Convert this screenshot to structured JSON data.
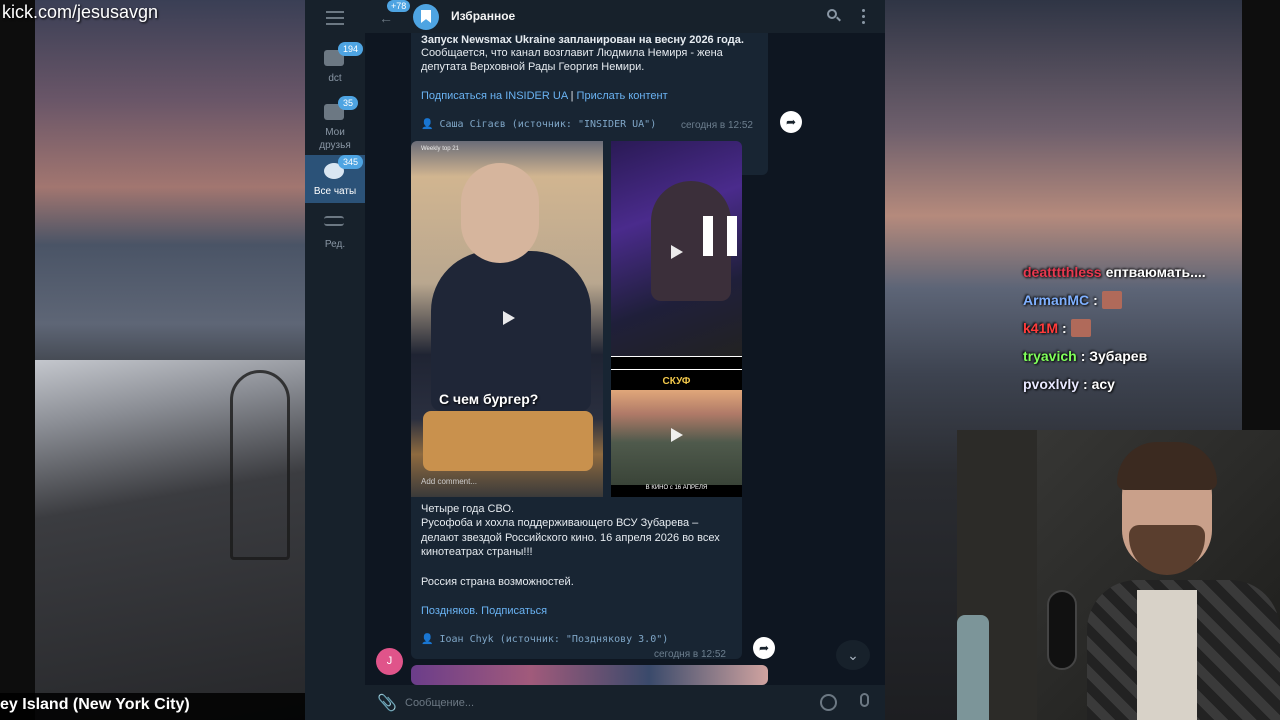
{
  "stream": {
    "url": "kick.com/jesusavgn",
    "location": "ey Island (New York City)"
  },
  "chat": [
    {
      "user": "deatttthless",
      "text": "ептваюмать....",
      "color": "#e8384f"
    },
    {
      "user": "ArmanMC",
      "text": ":",
      "color": "#7fb0ff"
    },
    {
      "user": "k41M",
      "text": ":",
      "color": "#ff3b3b"
    },
    {
      "user": "tryavich",
      "text": ": Зубарев",
      "color": "#7fff5a"
    },
    {
      "user": "pvoxlvly",
      "text": ": асу",
      "color": "#e8e8ff"
    }
  ],
  "telegram": {
    "sidebar": {
      "folders": [
        {
          "label": "dct",
          "badge": "194"
        },
        {
          "label": "Мои друзья",
          "badge": "35"
        },
        {
          "label": "Все чаты",
          "badge": "345"
        },
        {
          "label": "Ред."
        }
      ]
    },
    "header": {
      "back_badge": "78",
      "title": "Избранное"
    },
    "msg1": {
      "line0": "Запуск Newsmax Ukraine запланирован на весну 2026 года.",
      "line1": "Сообщается, что канал возглавит Людмила Немиря - жена",
      "line2": "депутата Верховной Рады Георгия Немири.",
      "link1": "Подписаться на INSIDER UA",
      "sep": "|",
      "link2": "Прислать контент",
      "forward": "Саша Сігаєв (источник: \"INSIDER UA\")",
      "time": "сегодня в 12:52"
    },
    "msg2": {
      "media_tag": "Weekly top 21",
      "burger_text": "С чем бургер?",
      "add_comment": "Add comment...",
      "skuf": "СКУФ",
      "city_caption": "В КИНО с 16 АПРЕЛЯ",
      "line0": "Четыре года СВО.",
      "line1": "Русофоба и хохла поддерживающего ВСУ Зубарева –",
      "line2": "делают звездой Российского кино. 16 апреля 2026 во всех",
      "line3": "кинотеатрах страны!!!",
      "line4": "Россия страна возможностей.",
      "link": "Поздняков. Подписаться",
      "forward": "Іоан Chyk (источник: \"Позднякову 3.0\")",
      "time": "сегодня в 12:52"
    },
    "sender_initial": "J",
    "input_placeholder": "Сообщение..."
  },
  "icons": {
    "menu": "hamburger-icon",
    "back": "back-arrow-icon",
    "search": "search-icon",
    "more": "more-vertical-icon",
    "share": "share-arrow-icon",
    "attach": "paperclip-icon",
    "emoji": "emoji-icon",
    "mic": "microphone-icon",
    "scroll": "chevron-down-icon"
  },
  "colors": {
    "accent": "#4ea4e2",
    "link": "#6ab3f3",
    "bubble": "#182533",
    "app_bg": "#0e1621"
  }
}
